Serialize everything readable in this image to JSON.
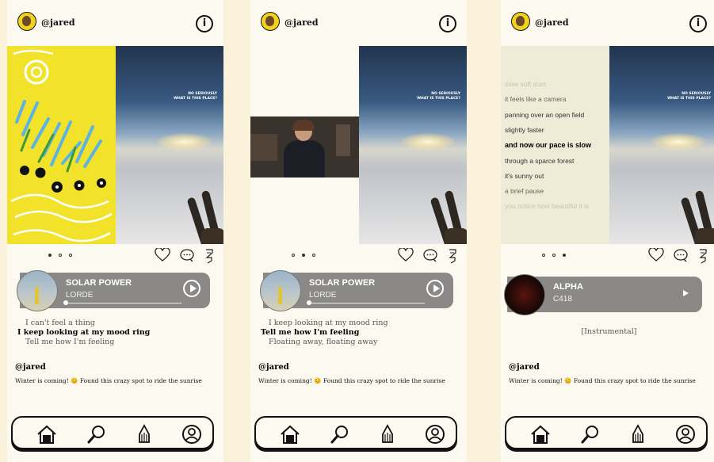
{
  "screens": [
    {
      "header": {
        "username": "@jared",
        "info_glyph": "i"
      },
      "media": {
        "left_panel": "doodle",
        "photo_caption_line1": "NO SERIOUSLY",
        "photo_caption_line2": "WHAT IS THIS PLACE?"
      },
      "carousel": {
        "count": 3,
        "active_index": 0
      },
      "player": {
        "track": "SOLAR POWER",
        "artist": "LORDE",
        "progress": 0.0,
        "album": "solar-power-cover"
      },
      "song_lyrics": {
        "prev": "I can't feel a thing",
        "current": "I keep looking at my mood ring",
        "next": "Tell me how I'm feeling"
      },
      "post": {
        "author": "@jared",
        "caption": "Winter is coming! 😊 Found this crazy spot to ride the sunrise"
      }
    },
    {
      "header": {
        "username": "@jared",
        "info_glyph": "i"
      },
      "media": {
        "left_panel": "webcam",
        "photo_caption_line1": "NO SERIOUSLY",
        "photo_caption_line2": "WHAT IS THIS PLACE?"
      },
      "carousel": {
        "count": 3,
        "active_index": 1
      },
      "player": {
        "track": "SOLAR POWER",
        "artist": "LORDE",
        "progress": 0.0,
        "album": "solar-power-cover"
      },
      "song_lyrics": {
        "prev": "I keep looking at my mood ring",
        "current": "Tell me how I'm feeling",
        "next": "Floating away, floating away"
      },
      "post": {
        "author": "@jared",
        "caption": "Winter is coming! 😊 Found this crazy spot to ride the sunrise"
      }
    },
    {
      "header": {
        "username": "@jared",
        "info_glyph": "i"
      },
      "media": {
        "left_panel": "lyrics",
        "photo_caption_line1": "NO SERIOUSLY",
        "photo_caption_line2": "WHAT IS THIS PLACE?",
        "panel_lines": [
          "slow soft start",
          "it feels like a camera",
          "panning over an open field",
          "slightly faster",
          "and now our pace is slow",
          "through a sparce forest",
          "it's sunny out",
          "a brief pause",
          "you notice how beautiful it is"
        ]
      },
      "carousel": {
        "count": 3,
        "active_index": 2
      },
      "player": {
        "track": "ALPHA",
        "artist": "C418",
        "album": "alpha-cover"
      },
      "instrumental": "[Instrumental]",
      "post": {
        "author": "@jared",
        "caption": "Winter is coming! 😊 Found this crazy spot to ride the sunrise"
      }
    }
  ],
  "actions": [
    "heart-icon",
    "comment-icon",
    "pencil-icon"
  ],
  "nav": [
    "home-icon",
    "search-icon",
    "pen-nib-icon",
    "profile-icon"
  ],
  "colors": {
    "background": "#FAF2DA",
    "screen": "#FCFAF0",
    "doodle": "#F3E22A",
    "player": "#8a8987"
  }
}
